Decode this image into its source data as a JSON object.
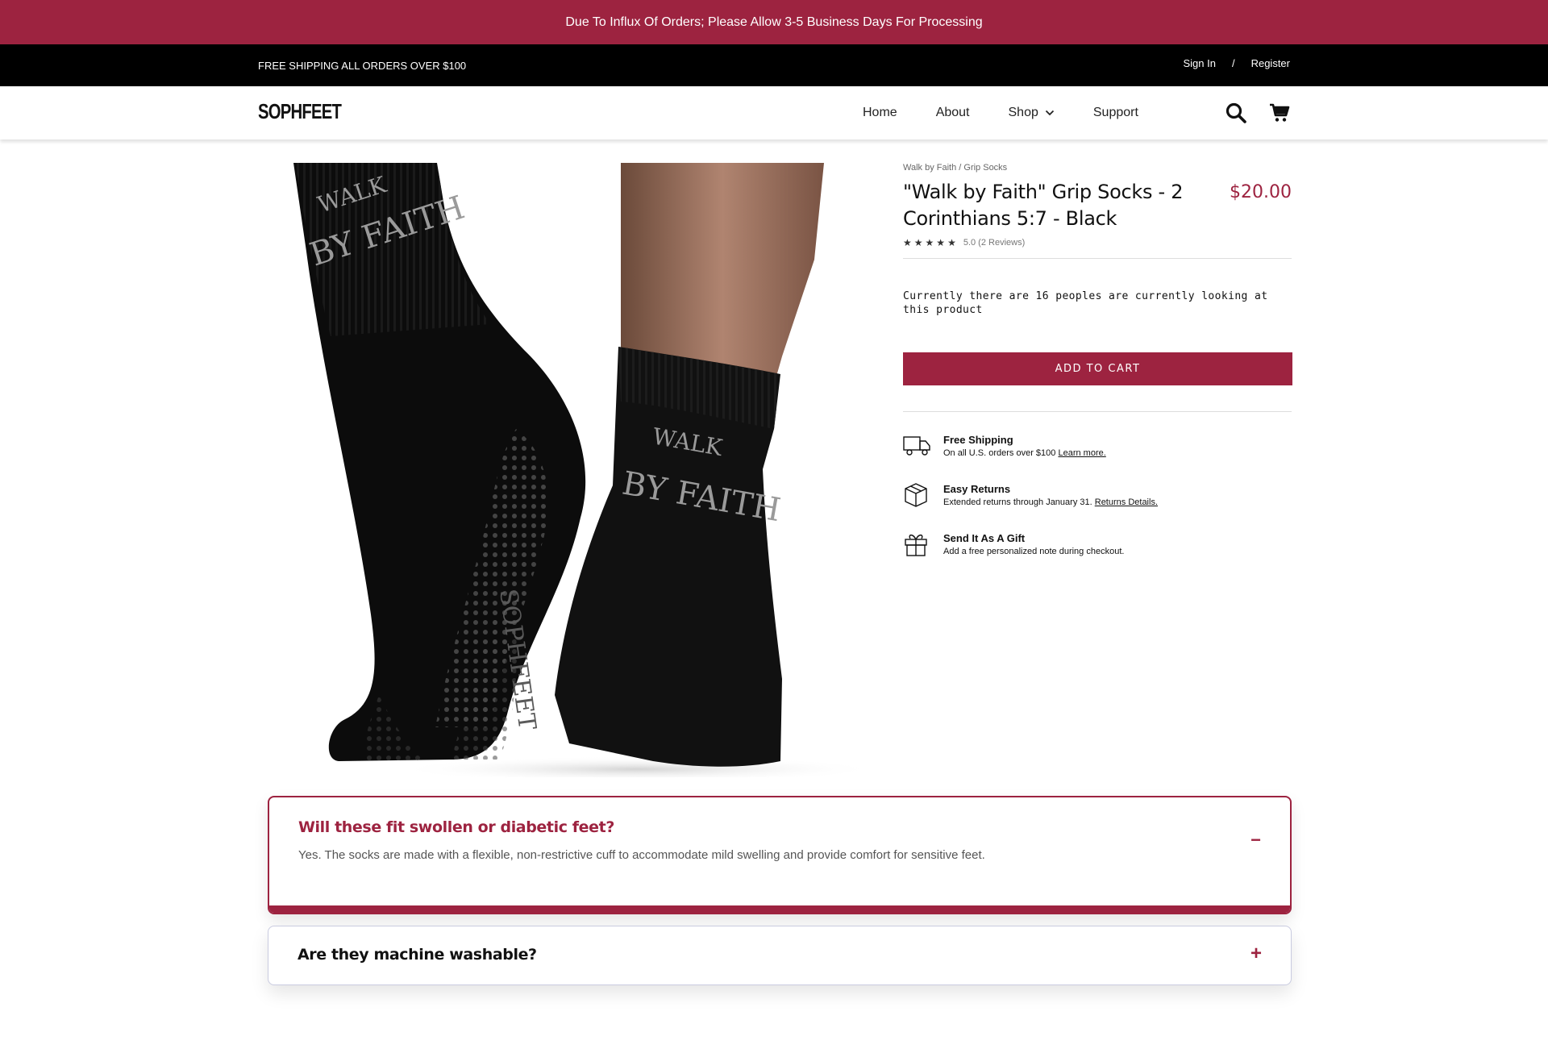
{
  "announcement": "Due To Influx Of Orders; Please Allow 3-5 Business Days For Processing",
  "topbar": {
    "shipping_text": "FREE SHIPPING ALL ORDERS OVER $100",
    "sign_in": "Sign In",
    "separator": "/",
    "register": "Register"
  },
  "header": {
    "logo": "SOPHFEET",
    "nav": [
      "Home",
      "About",
      "Shop",
      "Support"
    ],
    "icons": [
      "search-icon",
      "cart-icon"
    ]
  },
  "product": {
    "image_text": {
      "left_sock_line1": "WALK",
      "left_sock_line2": "BY FAITH",
      "right_sock_line1": "WALK",
      "right_sock_line2": "BY FAITH",
      "sole_brand": "SOPHFEET"
    },
    "breadcrumb": "Walk by Faith / Grip Socks",
    "title": "\"Walk by Faith\" Grip Socks - 2 Corinthians 5:7 - Black",
    "price": "$20.00",
    "rating_stars": 5,
    "rating_text": "5.0 (2 Reviews)",
    "viewers_text": "Currently there are 16 peoples are currently looking at this product",
    "add_to_cart": "ADD TO CART",
    "accent_color": "#9d2340"
  },
  "perks": [
    {
      "icon": "truck-icon",
      "title": "Free Shipping",
      "desc": "On all U.S. orders over $100",
      "link": "Learn more."
    },
    {
      "icon": "box-icon",
      "title": "Easy Returns",
      "desc": "Extended returns through January 31.",
      "link": "Returns Details."
    },
    {
      "icon": "gift-icon",
      "title": "Send It As A Gift",
      "desc": "Add a free personalized note during checkout.",
      "link": ""
    }
  ],
  "faq": [
    {
      "question": "Will these fit swollen or diabetic feet?",
      "answer": "Yes. The socks are made with a flexible, non-restrictive cuff to accommodate mild swelling and provide comfort for sensitive feet.",
      "toggle": "−"
    },
    {
      "question": "Are they machine washable?",
      "answer": "",
      "toggle": "+"
    }
  ]
}
